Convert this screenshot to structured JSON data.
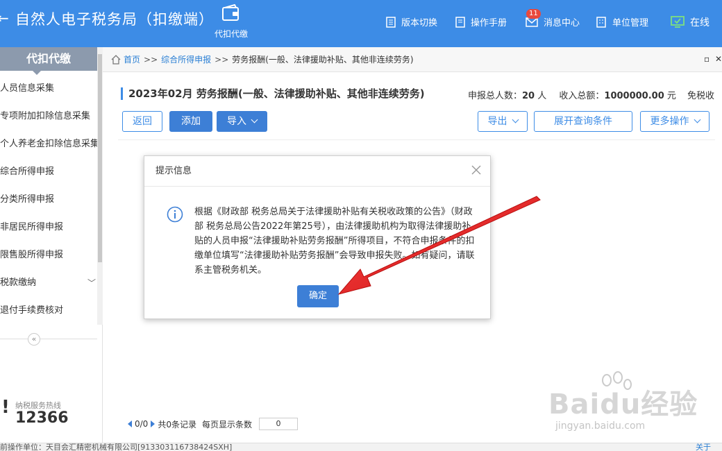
{
  "header": {
    "app_title": "自然人电子税务局（扣缴端）",
    "module_label": "代扣代缴",
    "nav": {
      "version_switch": "版本切换",
      "manual": "操作手册",
      "messages": "消息中心",
      "messages_badge": "11",
      "unit_manage": "单位管理",
      "online": "在线"
    }
  },
  "sidebar": {
    "title": "代扣代缴",
    "items": [
      {
        "label": "人员信息采集"
      },
      {
        "label": "专项附加扣除信息采集"
      },
      {
        "label": "个人养老金扣除信息采集"
      },
      {
        "label": "综合所得申报"
      },
      {
        "label": "分类所得申报"
      },
      {
        "label": "非居民所得申报"
      },
      {
        "label": "限售股所得申报"
      },
      {
        "label": "税款缴纳"
      },
      {
        "label": "退付手续费核对"
      }
    ],
    "collapse_symbol": "«",
    "hotline_label": "纳税服务热线",
    "hotline_number": "12366"
  },
  "breadcrumb": {
    "home": "首页",
    "sep": ">>",
    "level1": "综合所得申报",
    "current": "劳务报酬(一般、法律援助补贴、其他非连续劳务)"
  },
  "main": {
    "title": "2023年02月 劳务报酬(一般、法律援助补贴、其他非连续劳务)",
    "summary_label1": "申报总人数：",
    "summary_value1": "20",
    "summary_unit1": " 人",
    "summary_label2": "收入总额：",
    "summary_value2": "1000000.00",
    "summary_unit2": " 元",
    "summary_label3": "免税收",
    "buttons": {
      "back": "返回",
      "add": "添加",
      "import": "导入",
      "export": "导出",
      "expand_query": "展开查询条件",
      "more": "更多操作"
    },
    "pager": {
      "page": "0/0",
      "total": "共0条记录",
      "per_page_label": "每页显示条数",
      "per_page_value": "0"
    }
  },
  "modal": {
    "title": "提示信息",
    "message": "根据《财政部 税务总局关于法律援助补贴有关税收政策的公告》（财政部 税务总局公告2022年第25号），由法律援助机构为取得法律援助补贴的人员申报“法律援助补贴劳务报酬”所得项目，不符合申报条件的扣缴单位填写“法律援助补贴劳务报酬”会导致申报失败。如有疑问，请联系主管税务机关。",
    "ok": "确定"
  },
  "status_bar": {
    "text": "前操作单位：天目会汇精密机械有限公司[913303116738424SXH]",
    "link": "关于"
  },
  "watermark": {
    "logo": "Baidu经验",
    "url": "jingyan.baidu.com"
  },
  "colors": {
    "header_bg": "#3d8ce6",
    "primary": "#3d7fd6",
    "arrow": "#e21d1d",
    "badge": "#e8493d"
  }
}
